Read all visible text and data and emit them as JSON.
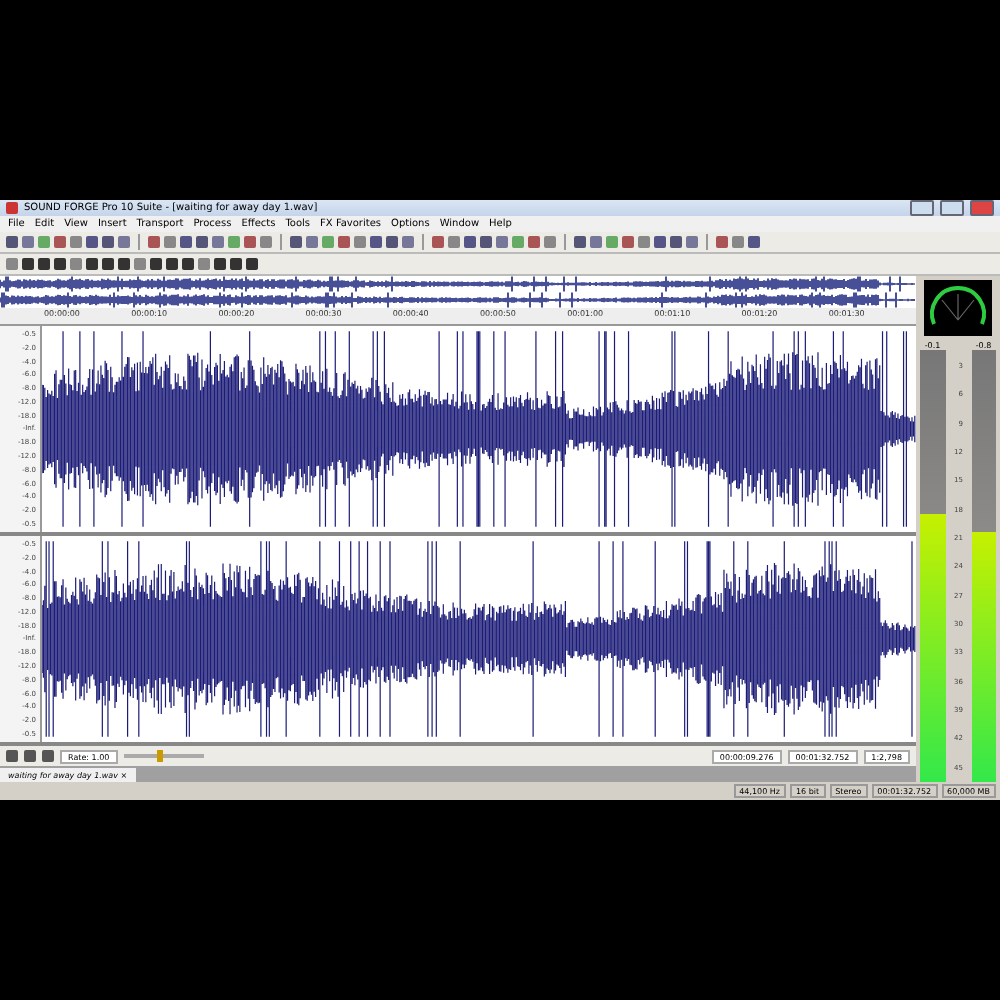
{
  "window": {
    "title": "SOUND FORGE Pro 10 Suite - [waiting for away day 1.wav]"
  },
  "menu": [
    "File",
    "Edit",
    "View",
    "Insert",
    "Transport",
    "Process",
    "Effects",
    "Tools",
    "FX Favorites",
    "Options",
    "Window",
    "Help"
  ],
  "ruler": [
    "00:00:00",
    "00:00:10",
    "00:00:20",
    "00:00:30",
    "00:00:40",
    "00:00:50",
    "00:01:00",
    "00:01:10",
    "00:01:20",
    "00:01:30"
  ],
  "tracks": [
    {
      "scale": [
        "-0.5",
        "-2.0",
        "-4.0",
        "-6.0",
        "-8.0",
        "-12.0",
        "-18.0",
        "-Inf.",
        "-18.0",
        "-12.0",
        "-8.0",
        "-6.0",
        "-4.0",
        "-2.0",
        "-0.5"
      ]
    },
    {
      "scale": [
        "-0.5",
        "-2.0",
        "-4.0",
        "-6.0",
        "-8.0",
        "-12.0",
        "-18.0",
        "-Inf.",
        "-18.0",
        "-12.0",
        "-8.0",
        "-6.0",
        "-4.0",
        "-2.0",
        "-0.5"
      ]
    }
  ],
  "transport": {
    "rate": "Rate: 1.00",
    "rate_slider": {
      "level": 0.45
    },
    "cursor": "00:00:09.276",
    "length": "00:01:32.752",
    "zoom": "1:2,798"
  },
  "document_tab": {
    "label": "waiting for away day 1.wav ×"
  },
  "status_bar": [
    "44,100 Hz",
    "16 bit",
    "Stereo",
    "00:01:32.752",
    "60,000 MB"
  ],
  "meters": {
    "channels": [
      {
        "peak": "-0.1",
        "level": 0.62
      },
      {
        "peak": "-0.8",
        "level": 0.58
      }
    ],
    "scale": [
      "3",
      "6",
      "9",
      "12",
      "15",
      "18",
      "21",
      "24",
      "27",
      "30",
      "33",
      "36",
      "39",
      "42",
      "45"
    ]
  }
}
